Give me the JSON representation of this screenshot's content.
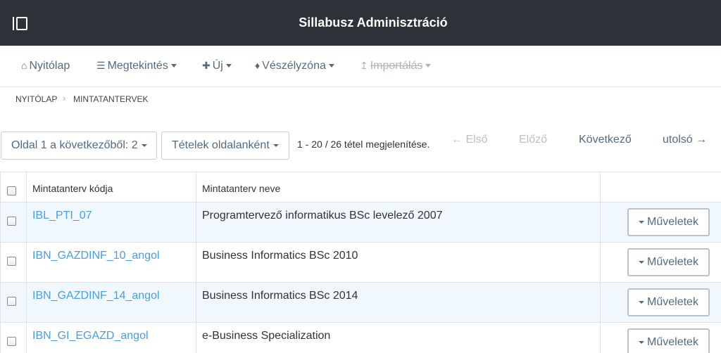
{
  "header": {
    "title": "Sillabusz Adminisztráció"
  },
  "nav": [
    {
      "label": "Nyitólap",
      "icon": "home-icon",
      "glyph": "⌂",
      "caret": false,
      "disabled": false
    },
    {
      "label": "Megtekintés",
      "icon": "list-icon",
      "glyph": "☰",
      "caret": true,
      "disabled": false
    },
    {
      "label": "Új",
      "icon": "plus-icon",
      "glyph": "✚",
      "caret": true,
      "disabled": false
    },
    {
      "label": "Vészélyzóna",
      "icon": "drop-icon",
      "glyph": "♦",
      "caret": true,
      "disabled": false
    },
    {
      "label": "Importálás",
      "icon": "upload-icon",
      "glyph": "↥",
      "caret": true,
      "disabled": true
    }
  ],
  "breadcrumb": {
    "home": "Nyitólap",
    "current": "Mintatantervek"
  },
  "pager": {
    "page_select": "Oldal 1 a következőből: 2",
    "per_page": "Tételek oldalanként",
    "info": "1 - 20 / 26 tétel megjelenítése.",
    "first": "← Első",
    "prev": "Előző",
    "next": "Következő",
    "last": "utolsó →"
  },
  "table": {
    "columns": [
      "Mintatanterv kódja",
      "Mintatanterv neve"
    ],
    "action_label": "Műveletek",
    "rows": [
      {
        "code": "IBL_PTI_07",
        "name": "Programtervező informatikus BSc levelező 2007"
      },
      {
        "code": "IBN_GAZDINF_10_angol",
        "name": "Business Informatics BSc 2010"
      },
      {
        "code": "IBN_GAZDINF_14_angol",
        "name": "Business Informatics BSc 2014"
      },
      {
        "code": "IBN_GI_EGAZD_angol",
        "name": "e-Business Specialization"
      }
    ]
  },
  "colors": {
    "topbar": "#2d3238",
    "link": "#4a9fd6",
    "nav": "#556b7d",
    "row_stripe": "#f1f8fd"
  }
}
